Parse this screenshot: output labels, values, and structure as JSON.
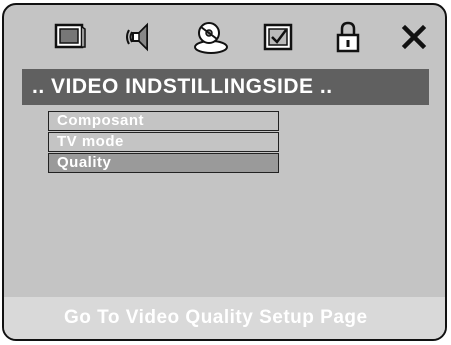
{
  "tabs": [
    {
      "icon": "monitor-icon"
    },
    {
      "icon": "speaker-icon"
    },
    {
      "icon": "disc-icon"
    },
    {
      "icon": "checkbox-icon"
    },
    {
      "icon": "padlock-icon"
    },
    {
      "icon": "close-icon"
    }
  ],
  "header": {
    "title": ".. VIDEO INDSTILLINGSIDE .."
  },
  "menu": {
    "items": [
      {
        "label": "Composant"
      },
      {
        "label": "TV  mode"
      },
      {
        "label": "Quality"
      }
    ],
    "selected_index": 2
  },
  "footer": {
    "hint": "Go To Video Quality Setup Page"
  },
  "colors": {
    "panel": "#c4c4c4",
    "title_bar": "#606060",
    "selected": "#9a9a9a",
    "footer": "#d9d9d9"
  }
}
